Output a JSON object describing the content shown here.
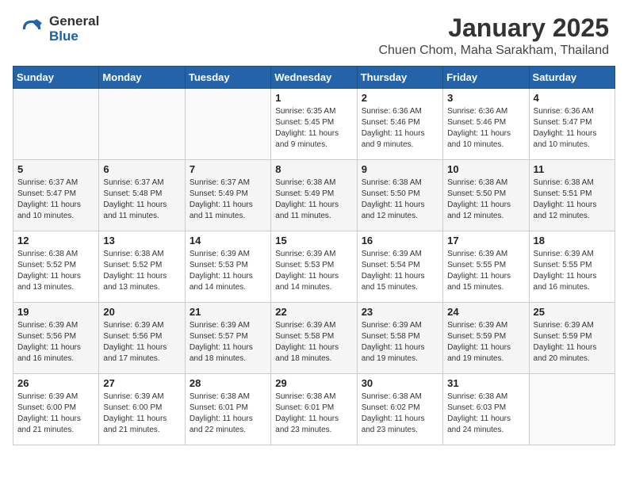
{
  "header": {
    "logo_general": "General",
    "logo_blue": "Blue",
    "title": "January 2025",
    "subtitle": "Chuen Chom, Maha Sarakham, Thailand"
  },
  "weekdays": [
    "Sunday",
    "Monday",
    "Tuesday",
    "Wednesday",
    "Thursday",
    "Friday",
    "Saturday"
  ],
  "weeks": [
    [
      {
        "day": "",
        "sunrise": "",
        "sunset": "",
        "daylight": ""
      },
      {
        "day": "",
        "sunrise": "",
        "sunset": "",
        "daylight": ""
      },
      {
        "day": "",
        "sunrise": "",
        "sunset": "",
        "daylight": ""
      },
      {
        "day": "1",
        "sunrise": "Sunrise: 6:35 AM",
        "sunset": "Sunset: 5:45 PM",
        "daylight": "Daylight: 11 hours and 9 minutes."
      },
      {
        "day": "2",
        "sunrise": "Sunrise: 6:36 AM",
        "sunset": "Sunset: 5:46 PM",
        "daylight": "Daylight: 11 hours and 9 minutes."
      },
      {
        "day": "3",
        "sunrise": "Sunrise: 6:36 AM",
        "sunset": "Sunset: 5:46 PM",
        "daylight": "Daylight: 11 hours and 10 minutes."
      },
      {
        "day": "4",
        "sunrise": "Sunrise: 6:36 AM",
        "sunset": "Sunset: 5:47 PM",
        "daylight": "Daylight: 11 hours and 10 minutes."
      }
    ],
    [
      {
        "day": "5",
        "sunrise": "Sunrise: 6:37 AM",
        "sunset": "Sunset: 5:47 PM",
        "daylight": "Daylight: 11 hours and 10 minutes."
      },
      {
        "day": "6",
        "sunrise": "Sunrise: 6:37 AM",
        "sunset": "Sunset: 5:48 PM",
        "daylight": "Daylight: 11 hours and 11 minutes."
      },
      {
        "day": "7",
        "sunrise": "Sunrise: 6:37 AM",
        "sunset": "Sunset: 5:49 PM",
        "daylight": "Daylight: 11 hours and 11 minutes."
      },
      {
        "day": "8",
        "sunrise": "Sunrise: 6:38 AM",
        "sunset": "Sunset: 5:49 PM",
        "daylight": "Daylight: 11 hours and 11 minutes."
      },
      {
        "day": "9",
        "sunrise": "Sunrise: 6:38 AM",
        "sunset": "Sunset: 5:50 PM",
        "daylight": "Daylight: 11 hours and 12 minutes."
      },
      {
        "day": "10",
        "sunrise": "Sunrise: 6:38 AM",
        "sunset": "Sunset: 5:50 PM",
        "daylight": "Daylight: 11 hours and 12 minutes."
      },
      {
        "day": "11",
        "sunrise": "Sunrise: 6:38 AM",
        "sunset": "Sunset: 5:51 PM",
        "daylight": "Daylight: 11 hours and 12 minutes."
      }
    ],
    [
      {
        "day": "12",
        "sunrise": "Sunrise: 6:38 AM",
        "sunset": "Sunset: 5:52 PM",
        "daylight": "Daylight: 11 hours and 13 minutes."
      },
      {
        "day": "13",
        "sunrise": "Sunrise: 6:38 AM",
        "sunset": "Sunset: 5:52 PM",
        "daylight": "Daylight: 11 hours and 13 minutes."
      },
      {
        "day": "14",
        "sunrise": "Sunrise: 6:39 AM",
        "sunset": "Sunset: 5:53 PM",
        "daylight": "Daylight: 11 hours and 14 minutes."
      },
      {
        "day": "15",
        "sunrise": "Sunrise: 6:39 AM",
        "sunset": "Sunset: 5:53 PM",
        "daylight": "Daylight: 11 hours and 14 minutes."
      },
      {
        "day": "16",
        "sunrise": "Sunrise: 6:39 AM",
        "sunset": "Sunset: 5:54 PM",
        "daylight": "Daylight: 11 hours and 15 minutes."
      },
      {
        "day": "17",
        "sunrise": "Sunrise: 6:39 AM",
        "sunset": "Sunset: 5:55 PM",
        "daylight": "Daylight: 11 hours and 15 minutes."
      },
      {
        "day": "18",
        "sunrise": "Sunrise: 6:39 AM",
        "sunset": "Sunset: 5:55 PM",
        "daylight": "Daylight: 11 hours and 16 minutes."
      }
    ],
    [
      {
        "day": "19",
        "sunrise": "Sunrise: 6:39 AM",
        "sunset": "Sunset: 5:56 PM",
        "daylight": "Daylight: 11 hours and 16 minutes."
      },
      {
        "day": "20",
        "sunrise": "Sunrise: 6:39 AM",
        "sunset": "Sunset: 5:56 PM",
        "daylight": "Daylight: 11 hours and 17 minutes."
      },
      {
        "day": "21",
        "sunrise": "Sunrise: 6:39 AM",
        "sunset": "Sunset: 5:57 PM",
        "daylight": "Daylight: 11 hours and 18 minutes."
      },
      {
        "day": "22",
        "sunrise": "Sunrise: 6:39 AM",
        "sunset": "Sunset: 5:58 PM",
        "daylight": "Daylight: 11 hours and 18 minutes."
      },
      {
        "day": "23",
        "sunrise": "Sunrise: 6:39 AM",
        "sunset": "Sunset: 5:58 PM",
        "daylight": "Daylight: 11 hours and 19 minutes."
      },
      {
        "day": "24",
        "sunrise": "Sunrise: 6:39 AM",
        "sunset": "Sunset: 5:59 PM",
        "daylight": "Daylight: 11 hours and 19 minutes."
      },
      {
        "day": "25",
        "sunrise": "Sunrise: 6:39 AM",
        "sunset": "Sunset: 5:59 PM",
        "daylight": "Daylight: 11 hours and 20 minutes."
      }
    ],
    [
      {
        "day": "26",
        "sunrise": "Sunrise: 6:39 AM",
        "sunset": "Sunset: 6:00 PM",
        "daylight": "Daylight: 11 hours and 21 minutes."
      },
      {
        "day": "27",
        "sunrise": "Sunrise: 6:39 AM",
        "sunset": "Sunset: 6:00 PM",
        "daylight": "Daylight: 11 hours and 21 minutes."
      },
      {
        "day": "28",
        "sunrise": "Sunrise: 6:38 AM",
        "sunset": "Sunset: 6:01 PM",
        "daylight": "Daylight: 11 hours and 22 minutes."
      },
      {
        "day": "29",
        "sunrise": "Sunrise: 6:38 AM",
        "sunset": "Sunset: 6:01 PM",
        "daylight": "Daylight: 11 hours and 23 minutes."
      },
      {
        "day": "30",
        "sunrise": "Sunrise: 6:38 AM",
        "sunset": "Sunset: 6:02 PM",
        "daylight": "Daylight: 11 hours and 23 minutes."
      },
      {
        "day": "31",
        "sunrise": "Sunrise: 6:38 AM",
        "sunset": "Sunset: 6:03 PM",
        "daylight": "Daylight: 11 hours and 24 minutes."
      },
      {
        "day": "",
        "sunrise": "",
        "sunset": "",
        "daylight": ""
      }
    ]
  ]
}
